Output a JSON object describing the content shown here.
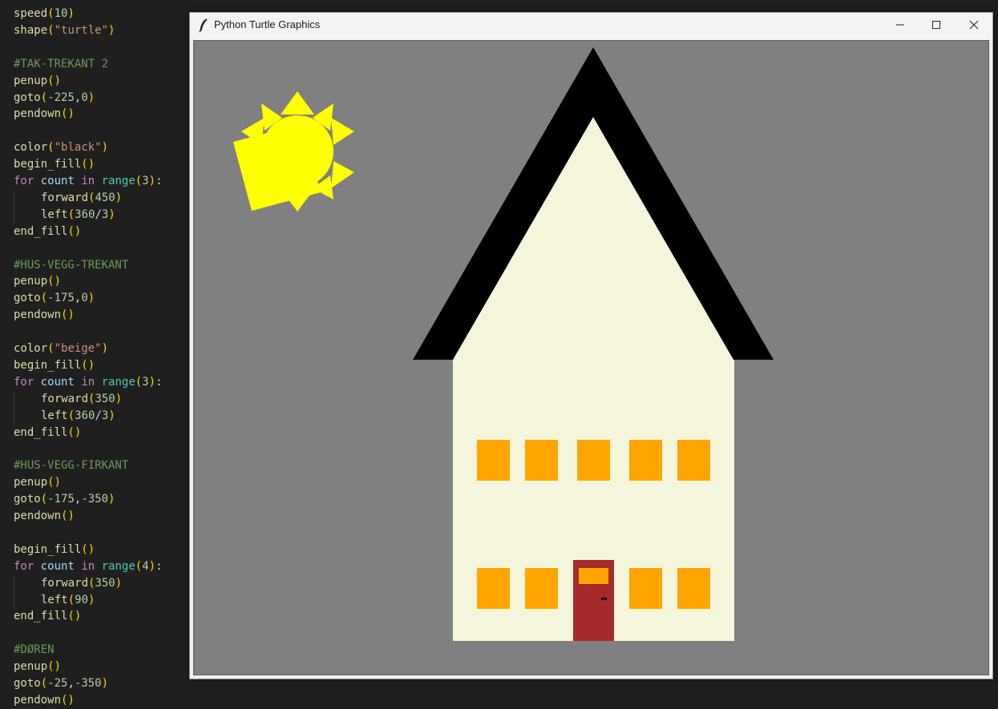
{
  "window": {
    "title": "Python Turtle Graphics",
    "minimize_label": "Minimize",
    "maximize_label": "Maximize",
    "close_label": "Close"
  },
  "editor": {
    "lines": [
      "speed(10)",
      "shape(\"turtle\")",
      "",
      "#TAK-TREKANT 2",
      "penup()",
      "goto(-225,0)",
      "pendown()",
      "",
      "color(\"black\")",
      "begin_fill()",
      "for count in range(3):",
      "    forward(450)",
      "    left(360/3)",
      "end_fill()",
      "",
      "#HUS-VEGG-TREKANT",
      "penup()",
      "goto(-175,0)",
      "pendown()",
      "",
      "color(\"beige\")",
      "begin_fill()",
      "for count in range(3):",
      "    forward(350)",
      "    left(360/3)",
      "end_fill()",
      "",
      "#HUS-VEGG-FIRKANT",
      "penup()",
      "goto(-175,-350)",
      "pendown()",
      "",
      "begin_fill()",
      "for count in range(4):",
      "    forward(350)",
      "    left(90)",
      "end_fill()",
      "",
      "#DØREN",
      "penup()",
      "goto(-25,-350)",
      "pendown()"
    ]
  },
  "colors": {
    "canvas_bg": "#808080",
    "roof": "#000000",
    "wall": "#f5f5dc",
    "window": "#ffa500",
    "door": "#a52a2a",
    "sun": "#ffff00"
  }
}
